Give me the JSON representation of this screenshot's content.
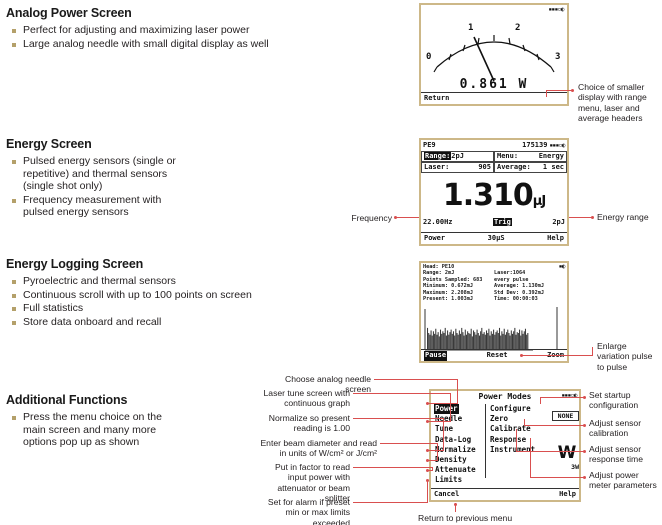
{
  "sections": [
    {
      "title": "Analog Power Screen",
      "bullets": [
        "Perfect for adjusting and maximizing laser power",
        "Large analog needle with small digital display as well"
      ]
    },
    {
      "title": "Energy Screen",
      "bullets": [
        "Pulsed energy sensors (single or repetitive) and thermal sensors (single shot only)",
        "Frequency measurement with pulsed energy sensors"
      ]
    },
    {
      "title": "Energy Logging Screen",
      "bullets": [
        "Pyroelectric and thermal sensors",
        "Continuous scroll with up to 100 points on screen",
        "Full statistics",
        "Store data onboard and recall"
      ]
    },
    {
      "title": "Additional Functions",
      "bullets": [
        "Press the menu choice on the main screen and many more options pop up as shown"
      ]
    }
  ],
  "analog_screen": {
    "scale_labels": [
      "0",
      "1",
      "2",
      "3"
    ],
    "value": "0.861",
    "unit": "W",
    "value_display": "0.861  W",
    "softkey_left": "Return",
    "battery_icon": "battery-icon"
  },
  "energy_screen": {
    "head": "PE9",
    "serial": "175139",
    "range_label": "Range:",
    "range_value": "2pJ",
    "menu_label": "Menu:",
    "menu_value": "Energy",
    "laser_label": "Laser:",
    "laser_value": "905",
    "average_label": "Average:",
    "average_value": "1 sec",
    "reading": "1.310",
    "reading_unit": "µJ",
    "frequency": "22.00Hz",
    "trig_badge": "Trig",
    "range_bottom": "2pJ",
    "softkey_left": "Power",
    "softkey_mid": "30µS",
    "softkey_right": "Help"
  },
  "logging_screen": {
    "stats_left": [
      "Head: PE10",
      "Range: 2mJ",
      "Points Sampled: 683",
      "Minimum: 0.672mJ",
      "Maximum: 2.208mJ",
      "Present: 1.003mJ"
    ],
    "stats_right": [
      "",
      "Laser:1064",
      "every pulse",
      "Average: 1.130mJ",
      "Std Dev: 0.392mJ",
      "Time:   00:00:03"
    ],
    "softkey_pause": "Pause",
    "softkey_reset": "Reset",
    "softkey_zoom": "Zoom",
    "bars": [
      26,
      20,
      18,
      23,
      17,
      22,
      19,
      25,
      18,
      21,
      16,
      24,
      19,
      22,
      20,
      26,
      17,
      23,
      18,
      21,
      24,
      19,
      22,
      17,
      25,
      20,
      18,
      23,
      19,
      26,
      21,
      17,
      24,
      18,
      22,
      20,
      19,
      25,
      16,
      23,
      21,
      18,
      24,
      20,
      17,
      22,
      26,
      19,
      21,
      18,
      23,
      20,
      25,
      17,
      22,
      19,
      24,
      18,
      21,
      23,
      20,
      26,
      17,
      22,
      19,
      25,
      18,
      21,
      24,
      20,
      17,
      23,
      19,
      22,
      26,
      18,
      21,
      20,
      24,
      17,
      23,
      19,
      22,
      25,
      18,
      20
    ]
  },
  "menu_screen": {
    "title": "Power Modes",
    "left_items": [
      "Power",
      "Needle",
      "Tune",
      "Data-Log",
      "Normalize",
      "Density",
      "Attenuate",
      "Limits"
    ],
    "selected_left": "Power",
    "right_items": [
      "Configure",
      "Zero",
      "Calibrate",
      "Response",
      "Instrument"
    ],
    "right_panel_label": "NONE",
    "right_panel_unit": "W",
    "right_panel_range": "3W",
    "softkey_left": "Cancel",
    "softkey_right": "Help"
  },
  "callouts": {
    "analog_right": "Choice of smaller display with range menu, laser and average headers",
    "energy_left": "Frequency",
    "energy_right": "Energy range",
    "logging_right": "Enlarge variation pulse to pulse",
    "menu_left": [
      "Choose analog needle screen",
      "Laser tune screen with continuous graph",
      "Normalize so present reading is 1.00",
      "Enter beam diameter and read in units of W/cm² or J/cm²",
      "Put in factor to read input power with attenuator or beam splitter",
      "Set for alarm if preset min or max limits exceeded"
    ],
    "menu_right": [
      "Set startup configuration",
      "Adjust sensor calibration",
      "Adjust sensor response time",
      "Adjust power meter parameters"
    ],
    "menu_bottom": "Return to previous menu"
  },
  "colors": {
    "bullet": "#b4a06a",
    "screen_border": "#cdb888",
    "leader_line": "#d94f4f"
  }
}
